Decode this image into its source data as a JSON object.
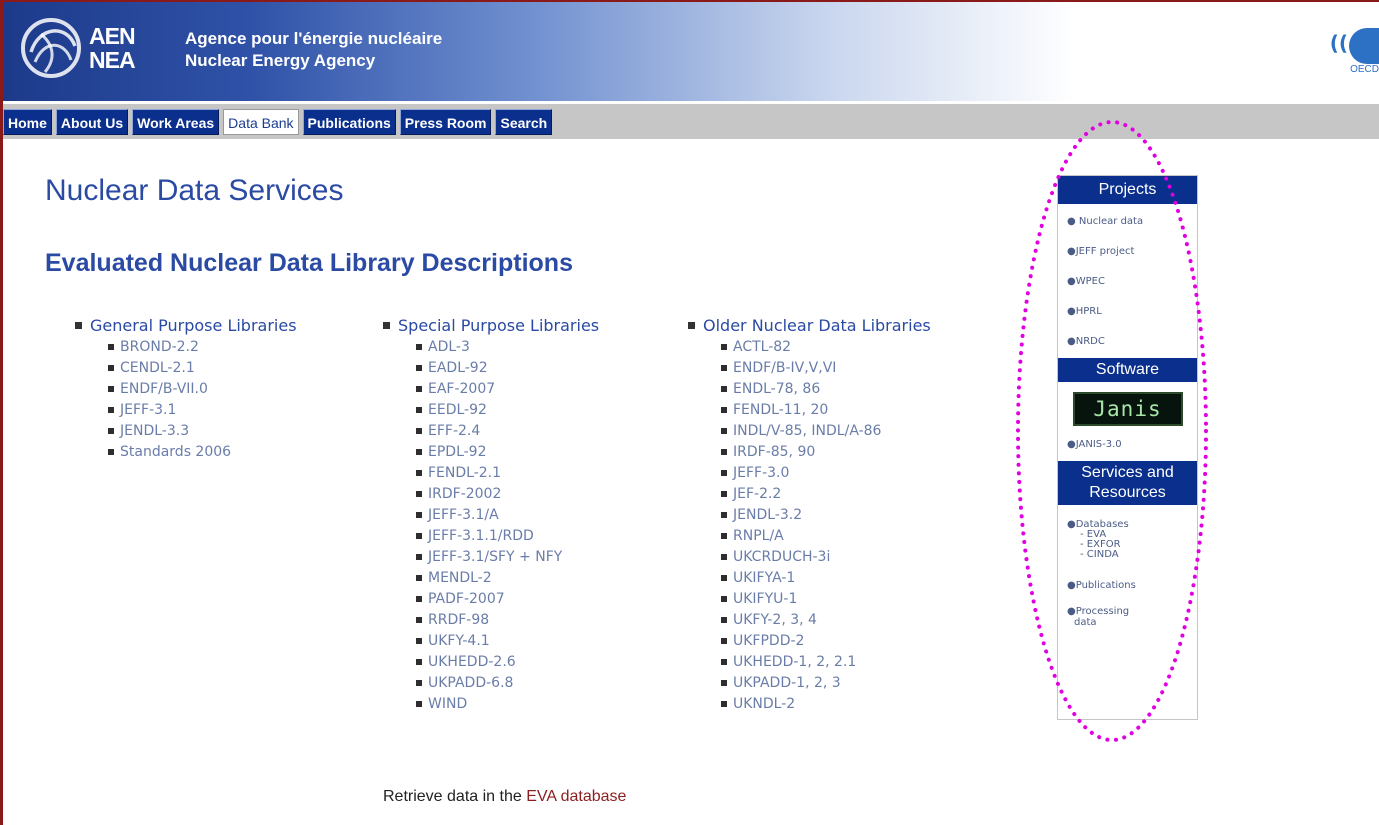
{
  "header": {
    "aen": "AEN",
    "nea": "NEA",
    "agency_fr": "Agence pour l'énergie nucléaire",
    "agency_en": "Nuclear Energy Agency",
    "oecd_text": "OECD"
  },
  "nav": {
    "tabs": [
      "Home",
      "About Us",
      "Work Areas",
      "Data Bank",
      "Publications",
      "Press Room",
      "Search"
    ],
    "active": "Data Bank"
  },
  "main": {
    "page_title": "Nuclear Data Services",
    "section_title": "Evaluated Nuclear Data Library Descriptions",
    "columns": [
      {
        "title": "General Purpose Libraries",
        "items": [
          "BROND-2.2",
          "CENDL-2.1",
          "ENDF/B-VII.0",
          "JEFF-3.1",
          "JENDL-3.3",
          "Standards 2006"
        ]
      },
      {
        "title": "Special Purpose Libraries",
        "items": [
          "ADL-3",
          "EADL-92",
          "EAF-2007",
          "EEDL-92",
          "EFF-2.4",
          "EPDL-92",
          "FENDL-2.1",
          "IRDF-2002",
          "JEFF-3.1/A",
          "JEFF-3.1.1/RDD",
          "JEFF-3.1/SFY + NFY",
          "MENDL-2",
          "PADF-2007",
          "RRDF-98",
          "UKFY-4.1",
          "UKHEDD-2.6",
          "UKPADD-6.8",
          "WIND"
        ]
      },
      {
        "title": "Older Nuclear Data Libraries",
        "items": [
          "ACTL-82",
          "ENDF/B-IV,V,VI",
          "ENDL-78, 86",
          "FENDL-11, 20",
          "INDL/V-85, INDL/A-86",
          "IRDF-85, 90",
          "JEFF-3.0",
          "JEF-2.2",
          "JENDL-3.2",
          "RNPL/A",
          "UKCRDUCH-3i",
          "UKIFYA-1",
          "UKIFYU-1",
          "UKFY-2, 3, 4",
          "UKFPDD-2",
          "UKHEDD-1, 2, 2.1",
          "UKPADD-1, 2, 3",
          "UKNDL-2"
        ]
      }
    ],
    "retrieve_prefix": "Retrieve data in the ",
    "retrieve_link": "EVA database"
  },
  "sidebar": {
    "projects_title": "Projects",
    "projects": [
      "Nuclear data",
      "JEFF project",
      "WPEC",
      "HPRL",
      "NRDC"
    ],
    "software_title": "Software",
    "janis_logo": "Janis",
    "janis_link": "JANIS-3.0",
    "services_title_1": "Services and",
    "services_title_2": "Resources",
    "databases_label": "Databases",
    "databases": [
      "EVA",
      "EXFOR",
      "CINDA"
    ],
    "publications": "Publications",
    "processing_1": "Processing",
    "processing_2": "data"
  },
  "colors": {
    "nav_blue": "#0a2f8c",
    "title_blue": "#2a4aa3",
    "link_gray_blue": "#6a7da8",
    "highlight_magenta": "#e000e0",
    "frame_red": "#8a1a1a"
  }
}
